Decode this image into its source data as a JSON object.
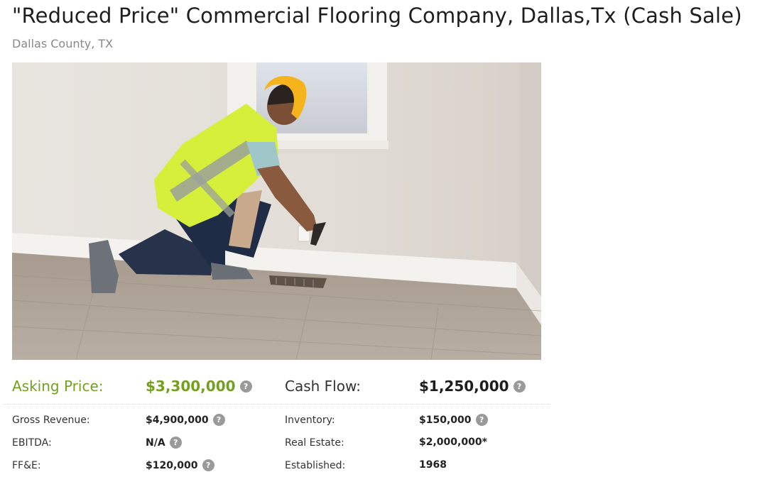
{
  "listing": {
    "title": "\"Reduced Price\" Commercial Flooring Company, Dallas,Tx (Cash Sale)",
    "location": "Dallas County, TX"
  },
  "photo": {
    "icon": "photo-worker-inspecting-floor"
  },
  "financials": {
    "asking_price": {
      "label": "Asking Price:",
      "value": "$3,300,000",
      "help": "?"
    },
    "cash_flow": {
      "label": "Cash Flow:",
      "value": "$1,250,000",
      "help": "?"
    },
    "gross_revenue": {
      "label": "Gross Revenue:",
      "value": "$4,900,000",
      "help": "?"
    },
    "inventory": {
      "label": "Inventory:",
      "value": "$150,000",
      "help": "?"
    },
    "ebitda": {
      "label": "EBITDA:",
      "value": "N/A",
      "help": "?"
    },
    "real_estate": {
      "label": "Real Estate:",
      "value": "$2,000,000*"
    },
    "ffe": {
      "label": "FF&E:",
      "value": "$120,000",
      "help": "?"
    },
    "established": {
      "label": "Established:",
      "value": "1968"
    }
  },
  "colors": {
    "accent_green": "#74a020",
    "help_icon_gray": "#9a9a9a"
  }
}
